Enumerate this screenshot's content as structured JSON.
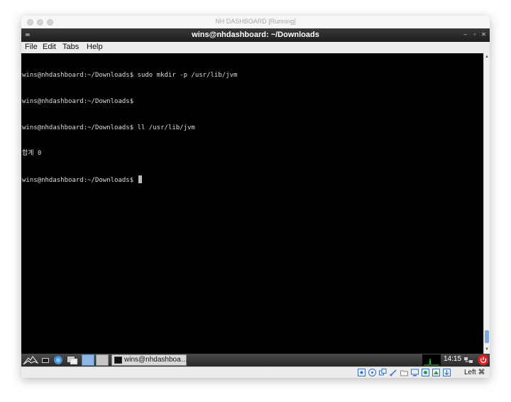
{
  "host_window": {
    "title": "NH DASHBOARD [Running]"
  },
  "guest_window": {
    "title": "wins@nhdashboard: ~/Downloads"
  },
  "menu": {
    "file": "File",
    "edit": "Edit",
    "tabs": "Tabs",
    "help": "Help"
  },
  "terminal": {
    "lines": [
      "wins@nhdashboard:~/Downloads$ sudo mkdir -p /usr/lib/jvm",
      "wins@nhdashboard:~/Downloads$",
      "wins@nhdashboard:~/Downloads$ ll /usr/lib/jvm",
      "합계 0",
      "wins@nhdashboard:~/Downloads$ "
    ]
  },
  "taskbar": {
    "task_label": "wins@nhdashboa…",
    "clock": "14:15"
  },
  "vbox_status": {
    "host_key": "Left ⌘"
  },
  "icons": {
    "window_menu": "window-menu-icon",
    "minimize": "minimize-icon",
    "maximize": "maximize-icon",
    "close": "close-icon",
    "kali_menu": "kali-dragon-icon",
    "power": "power-icon"
  },
  "colors": {
    "terminal_bg": "#000000",
    "terminal_fg": "#dedede",
    "power_red": "#e02020"
  }
}
